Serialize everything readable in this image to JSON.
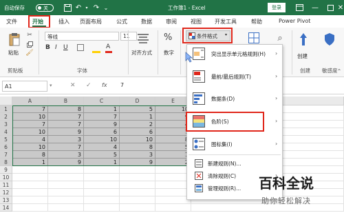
{
  "titlebar": {
    "autosave_label": "自动保存",
    "toggle_state": "关",
    "doc_title": "工作簿1 - Excel",
    "login_label": "登录"
  },
  "tabs": [
    "文件",
    "开始",
    "插入",
    "页面布局",
    "公式",
    "数据",
    "审阅",
    "视图",
    "开发工具",
    "帮助",
    "Power Pivot"
  ],
  "ribbon": {
    "paste_label": "粘贴",
    "clipboard_group": "剪贴板",
    "font_name": "等线",
    "font_size": "11",
    "font_group": "字体",
    "align_label": "对齐方式",
    "number_label": "数字",
    "cond_format_label": "条件格式",
    "create_label": "创建",
    "sensitivity_label": "敏感度"
  },
  "formula_bar": {
    "name_box": "A1",
    "fx": "fx",
    "value": "7"
  },
  "columns": [
    "A",
    "B",
    "C",
    "D",
    "E"
  ],
  "rows": [
    "1",
    "2",
    "3",
    "4",
    "5",
    "6",
    "7",
    "8",
    "9",
    "10",
    "11",
    "12",
    "13",
    "14"
  ],
  "cells": [
    [
      "7",
      "8",
      "1",
      "5",
      "10"
    ],
    [
      "10",
      "7",
      "7",
      "1",
      "9"
    ],
    [
      "7",
      "7",
      "9",
      "2",
      "4"
    ],
    [
      "10",
      "9",
      "6",
      "6",
      "7"
    ],
    [
      "4",
      "3",
      "10",
      "10",
      "8"
    ],
    [
      "10",
      "7",
      "4",
      "8",
      "5"
    ],
    [
      "8",
      "3",
      "5",
      "3",
      "1"
    ],
    [
      "1",
      "9",
      "1",
      "9",
      "2"
    ]
  ],
  "menu": {
    "items": [
      {
        "label": "突出显示单元格规则(H)",
        "has_sub": true
      },
      {
        "label": "最前/最后规则(T)",
        "has_sub": true
      },
      {
        "label": "数据条(D)",
        "has_sub": true
      },
      {
        "label": "色阶(S)",
        "has_sub": true
      },
      {
        "label": "图标集(I)",
        "has_sub": true
      },
      {
        "label": "新建规则(N)...",
        "has_sub": false
      },
      {
        "label": "清除规则(C)",
        "has_sub": true
      },
      {
        "label": "管理规则(R)...",
        "has_sub": false
      }
    ]
  },
  "watermark": {
    "line1": "百科全说",
    "line2": "助你轻松解决"
  },
  "colors": {
    "excel_green": "#217346",
    "highlight_red": "#e0261a",
    "selection_gray": "#c9c9c9"
  }
}
